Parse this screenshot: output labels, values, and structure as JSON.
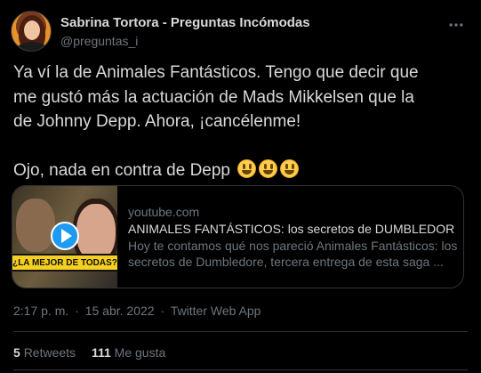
{
  "author": {
    "name": "Sabrina Tortora - Preguntas Incómodas",
    "handle": "@preguntas_i"
  },
  "tweet": {
    "lines": [
      "Ya ví la de Animales Fantásticos. Tengo que decir que",
      "me gustó más la actuación de Mads Mikkelsen que la",
      "de Johnny Depp. Ahora, ¡cancélenme!"
    ],
    "second_paragraph": "Ojo, nada en contra de Depp"
  },
  "link_card": {
    "domain": "youtube.com",
    "title": "ANIMALES FANTÁSTICOS: los secretos de DUMBLEDORE |...",
    "description_line1": "Hoy te contamos qué nos pareció Animales Fantásticos: los",
    "description_line2": "secretos de Dumbledore, tercera entrega de esta saga ...",
    "thumbnail_caption": "¿LA MEJOR DE TODAS?"
  },
  "meta": {
    "time": "2:17 p. m.",
    "date": "15 abr. 2022",
    "source": "Twitter Web App",
    "separator": "·"
  },
  "stats": {
    "retweets_count": "5",
    "retweets_label": "Retweets",
    "likes_count": "111",
    "likes_label": "Me gusta"
  },
  "colors": {
    "background": "#000000",
    "text": "#d9d9d9",
    "muted": "#6e767d",
    "accent": "#1d9bf0",
    "border": "#2f3336"
  }
}
